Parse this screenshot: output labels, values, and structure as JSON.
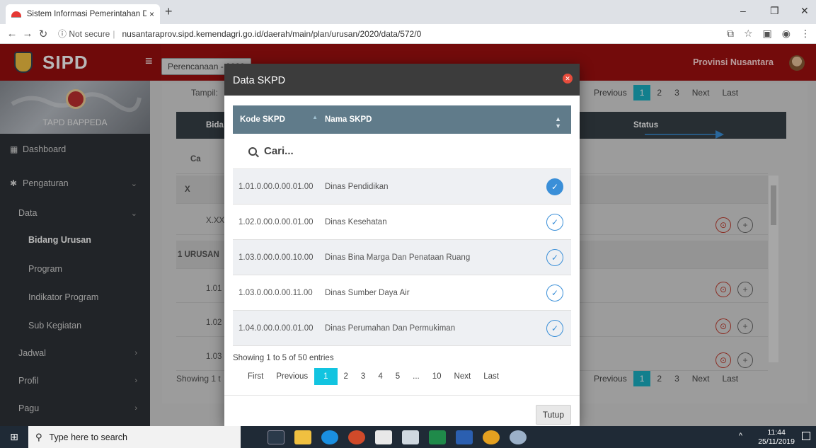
{
  "browser": {
    "tab_title": "Sistem Informasi Pemerintahan D",
    "tab_close": "×",
    "new_tab": "+",
    "url_info": "ⓘ Not secure",
    "url_sep": "|",
    "url": "nusantaraprov.sipd.kemendagri.go.id/daerah/main/plan/urusan/2020/data/572/0",
    "win_min": "–",
    "win_max": "❐",
    "win_close": "✕",
    "icons": [
      "translate-icon",
      "star-icon",
      "extension-icon",
      "profile-icon",
      "menu-icon"
    ]
  },
  "header": {
    "brand": "SIPD",
    "hamburger": "≡",
    "plan_button": "Perencanaan - 2020",
    "region": "Provinsi Nusantara"
  },
  "sidebar": {
    "banner_label": "TAPD BAPPEDA",
    "items": [
      {
        "label": "Dashboard",
        "icon": "▦"
      },
      {
        "label": "Pengaturan",
        "icon": "✱",
        "chevron": "⌄"
      },
      {
        "label": "Data",
        "chevron": "⌄"
      },
      {
        "label": "Bidang Urusan"
      },
      {
        "label": "Program"
      },
      {
        "label": "Indikator Program"
      },
      {
        "label": "Sub Kegiatan"
      },
      {
        "label": "Jadwal",
        "chevron": "›"
      },
      {
        "label": "Profil",
        "chevron": "›"
      },
      {
        "label": "Pagu",
        "chevron": "›"
      }
    ]
  },
  "background": {
    "tampil": "Tampil:",
    "pager": [
      "Previous",
      "1",
      "2",
      "3",
      "Next",
      "Last"
    ],
    "col_bidang": "Bida",
    "col_status": "Status",
    "search": "Ca",
    "rows": [
      "X",
      "X.XX",
      "1 URUSAN",
      "1.01",
      "1.02",
      "1.03"
    ],
    "showing": "Showing 1 t",
    "pager_bottom": [
      "Previous",
      "1",
      "2",
      "3",
      "Next",
      "Last"
    ]
  },
  "modal": {
    "title": "Data SKPD",
    "close": "✕",
    "col_kode": "Kode SKPD",
    "col_nama": "Nama SKPD",
    "search_placeholder": "Cari...",
    "rows": [
      {
        "kode": "1.01.0.00.0.00.01.00",
        "nama": "Dinas Pendidikan",
        "checked": true
      },
      {
        "kode": "1.02.0.00.0.00.01.00",
        "nama": "Dinas Kesehatan",
        "checked": false
      },
      {
        "kode": "1.03.0.00.0.00.10.00",
        "nama": "Dinas Bina Marga Dan Penataan Ruang",
        "checked": false
      },
      {
        "kode": "1.03.0.00.0.00.11.00",
        "nama": "Dinas Sumber Daya Air",
        "checked": false
      },
      {
        "kode": "1.04.0.00.0.00.01.00",
        "nama": "Dinas Perumahan Dan Permukiman",
        "checked": false
      }
    ],
    "info": "Showing 1 to 5 of 50 entries",
    "pager": [
      "First",
      "Previous",
      "1",
      "2",
      "3",
      "4",
      "5",
      "...",
      "10",
      "Next",
      "Last"
    ],
    "active_page": "1",
    "close_button": "Tutup"
  },
  "taskbar": {
    "search_placeholder": "Type here to search",
    "time": "11:44",
    "date": "25/11/2019",
    "tray": "^"
  },
  "colors": {
    "header_red": "#a01010",
    "table_head": "#607b8a",
    "check_blue": "#3a8fd8",
    "page_active": "#12c4e0"
  }
}
